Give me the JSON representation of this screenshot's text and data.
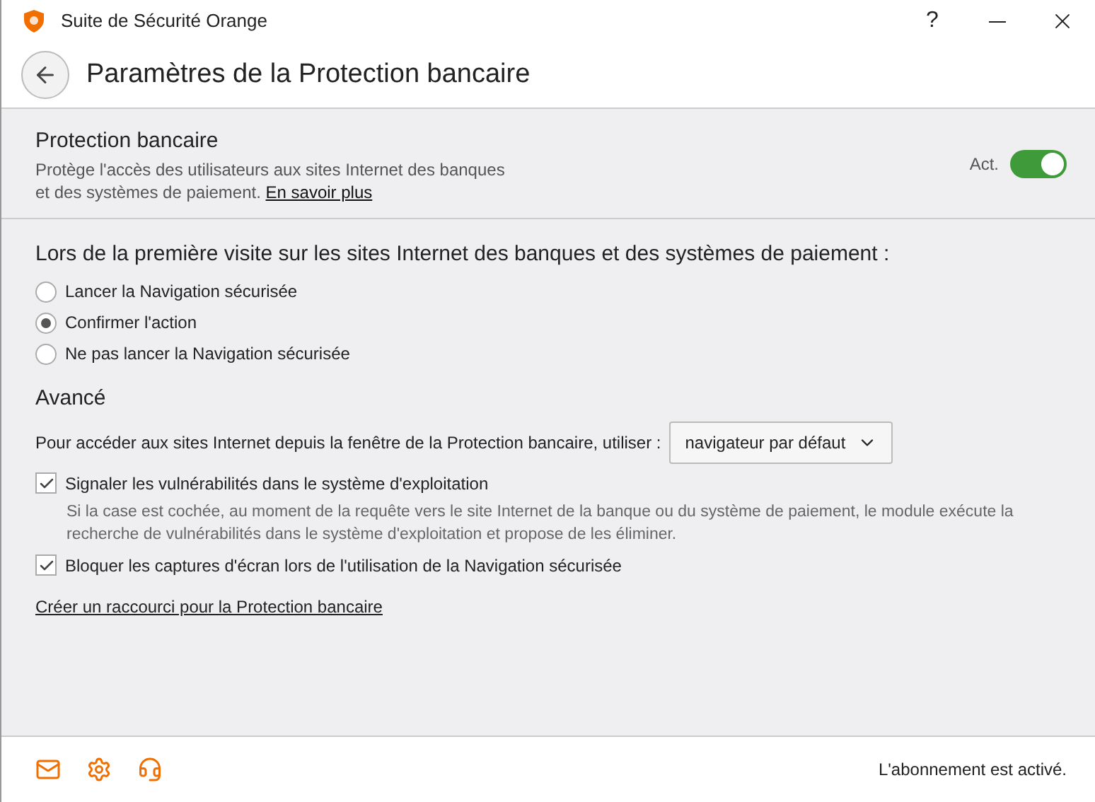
{
  "window": {
    "title": "Suite de Sécurité Orange",
    "help": "?"
  },
  "header": {
    "title": "Paramètres de la Protection bancaire"
  },
  "protection": {
    "title": "Protection bancaire",
    "description": "Protège l'accès des utilisateurs aux sites Internet des banques et des systèmes de paiement.",
    "link": "En savoir plus",
    "toggle_label": "Act.",
    "on": true
  },
  "first_visit": {
    "question": "Lors de la première visite sur les sites Internet des banques et des systèmes de paiement :",
    "options": [
      {
        "label": "Lancer la Navigation sécurisée",
        "selected": false
      },
      {
        "label": "Confirmer l'action",
        "selected": true
      },
      {
        "label": "Ne pas lancer la Navigation sécurisée",
        "selected": false
      }
    ]
  },
  "advanced": {
    "title": "Avancé",
    "browser_label": "Pour accéder aux sites Internet depuis la fenêtre de la Protection bancaire, utiliser :",
    "browser_value": "navigateur par défaut",
    "checkboxes": [
      {
        "label": "Signaler les vulnérabilités dans le système d'exploitation",
        "checked": true,
        "hint": "Si la case est cochée, au moment de la requête vers le site Internet de la banque ou du système de paiement, le module exécute la recherche de vulnérabilités dans le système d'exploitation et propose de les éliminer."
      },
      {
        "label": "Bloquer les captures d'écran lors de l'utilisation de la Navigation sécurisée",
        "checked": true
      }
    ],
    "shortcut_link": "Créer un raccourci pour la Protection bancaire"
  },
  "footer": {
    "status": "L'abonnement est activé."
  }
}
